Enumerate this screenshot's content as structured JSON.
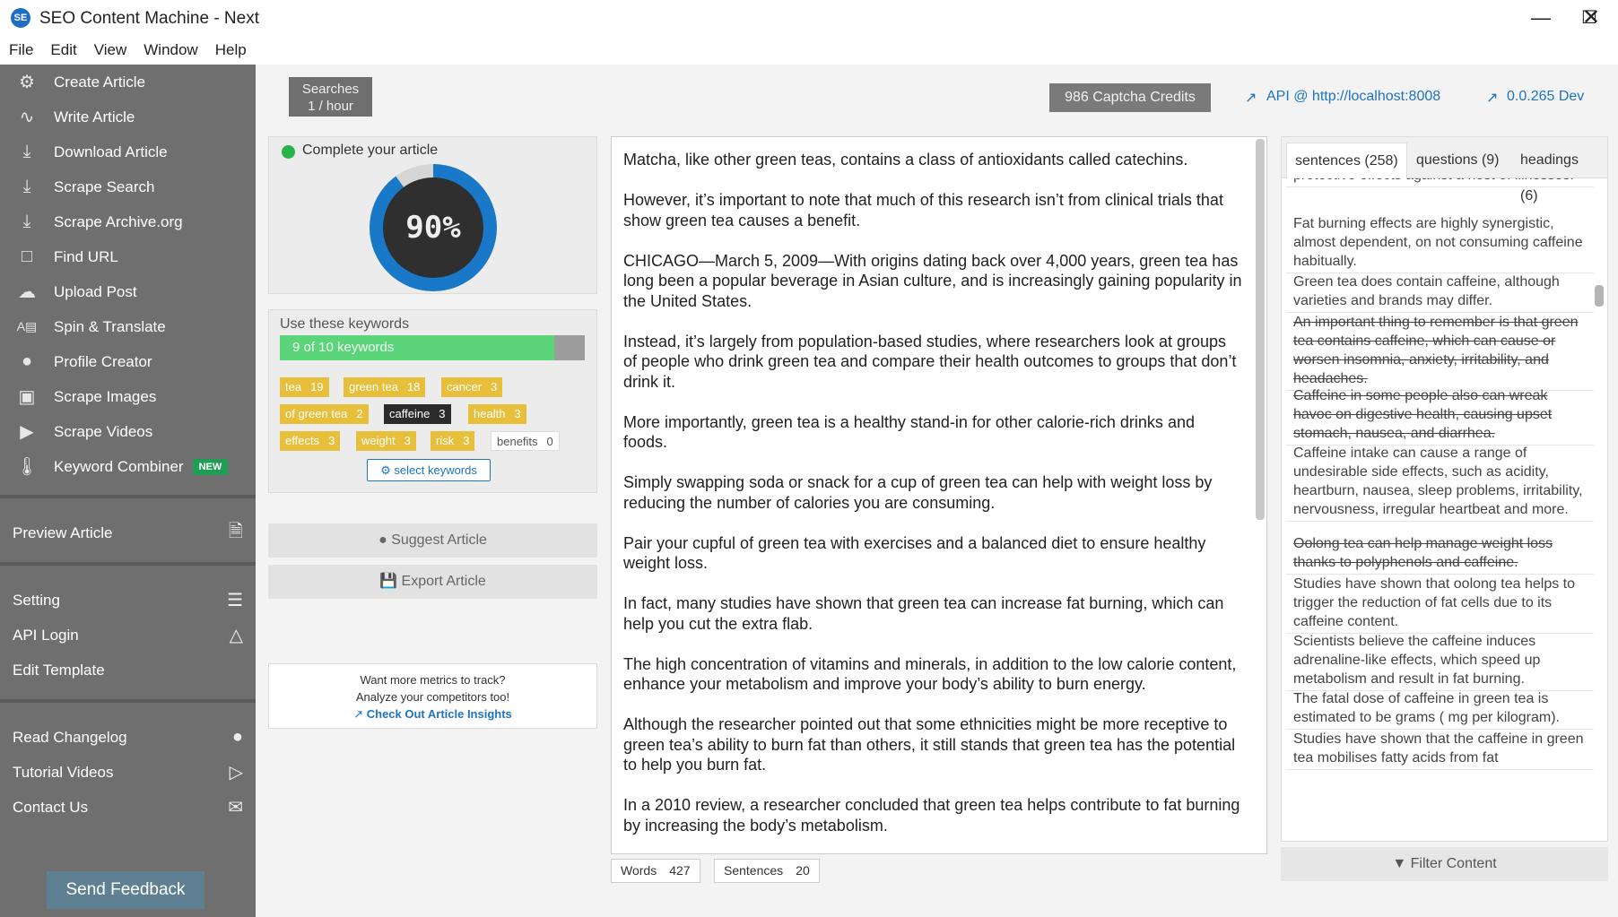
{
  "window": {
    "title": "SEO Content Machine - Next",
    "icon_text": "SE"
  },
  "menu": [
    "File",
    "Edit",
    "View",
    "Window",
    "Help"
  ],
  "sidebar": {
    "items": [
      {
        "label": "Create Article",
        "icon": "gear-icon"
      },
      {
        "label": "Write Article",
        "icon": "wave-icon"
      },
      {
        "label": "Download Article",
        "icon": "download-icon"
      },
      {
        "label": "Scrape Search",
        "icon": "download-icon"
      },
      {
        "label": "Scrape Archive.org",
        "icon": "download-icon"
      },
      {
        "label": "Find URL",
        "icon": "page-icon"
      },
      {
        "label": "Upload Post",
        "icon": "cloud-icon"
      },
      {
        "label": "Spin & Translate",
        "icon": "translate-icon"
      },
      {
        "label": "Profile Creator",
        "icon": "person-icon"
      },
      {
        "label": "Scrape Images",
        "icon": "image-icon"
      },
      {
        "label": "Scrape Videos",
        "icon": "video-icon"
      },
      {
        "label": "Keyword Combiner",
        "icon": "thermometer-icon",
        "badge": "NEW"
      }
    ],
    "preview": {
      "label": "Preview Article",
      "icon": "document-icon"
    },
    "settings": [
      {
        "label": "Setting",
        "icon": "sliders-icon"
      },
      {
        "label": "API Login",
        "icon": "flask-icon"
      },
      {
        "label": "Edit Template",
        "icon": ""
      }
    ],
    "help": [
      {
        "label": "Read Changelog",
        "icon": "lightbulb-icon"
      },
      {
        "label": "Tutorial Videos",
        "icon": "play-icon"
      },
      {
        "label": "Contact Us",
        "icon": "mail-icon"
      }
    ],
    "feedback": "Send Feedback"
  },
  "header": {
    "searches_line1": "Searches",
    "searches_line2": "1 / hour",
    "captcha": "986 Captcha Credits",
    "api_link": "API @ http://localhost:8008",
    "version_link": "0.0.265 Dev"
  },
  "progress": {
    "label": "Complete your article",
    "percent_text": "90%",
    "percent": 0.9
  },
  "keywords": {
    "label": "Use these keywords",
    "bar_text": "9 of 10 keywords",
    "fill": 0.9,
    "chips": [
      {
        "word": "tea",
        "count": "19",
        "style": "yellow"
      },
      {
        "word": "green tea",
        "count": "18",
        "style": "yellow"
      },
      {
        "word": "cancer",
        "count": "3",
        "style": "yellow"
      },
      {
        "word": "of green tea",
        "count": "2",
        "style": "yellow"
      },
      {
        "word": "caffeine",
        "count": "3",
        "style": "dark"
      },
      {
        "word": "health",
        "count": "3",
        "style": "yellow"
      },
      {
        "word": "effects",
        "count": "3",
        "style": "yellow"
      },
      {
        "word": "weight",
        "count": "3",
        "style": "yellow"
      },
      {
        "word": "risk",
        "count": "3",
        "style": "yellow"
      },
      {
        "word": "benefits",
        "count": "0",
        "style": "white"
      }
    ],
    "select_button": "select keywords"
  },
  "actions": {
    "suggest": "Suggest Article",
    "export": "Export Article"
  },
  "insights": {
    "line1": "Want more metrics to track?",
    "line2": "Analyze your competitors too!",
    "link": "Check Out Article Insights"
  },
  "article": {
    "paragraphs": [
      "Matcha, like other green teas, contains a class of antioxidants called catechins.",
      "However, it’s important to note that much of this research isn’t from clinical trials that show green tea causes a benefit.",
      "CHICAGO—March 5, 2009—With origins dating back over 4,000 years, green tea has long been a popular beverage in Asian culture, and is increasingly gaining popularity in the United States.",
      "Instead, it’s largely from population-based studies, where researchers look at groups of people who drink green tea and compare their health outcomes to groups that don’t drink it.",
      "More importantly, green tea is a healthy stand-in for other calorie-rich drinks and foods.",
      "Simply swapping soda or snack for a cup of green tea can help with weight loss by reducing the number of calories you are consuming.",
      "Pair your cupful of green tea with exercises and a balanced diet to ensure healthy weight loss.",
      "In fact, many studies have shown that green tea can increase fat burning, which can help you cut the extra flab.",
      "The high concentration of vitamins and minerals, in addition to the low calorie content, enhance your metabolism and improve your body’s ability to burn energy.",
      "Although the researcher pointed out that some ethnicities might be more receptive to green tea’s ability to burn fat than others, it still stands that green tea has the potential to help you burn fat.",
      "In a 2010 review, a researcher concluded that green tea helps contribute to fat burning by increasing the body’s metabolism."
    ]
  },
  "stats": {
    "words_label": "Words",
    "words": "427",
    "sentences_label": "Sentences",
    "sentences": "20"
  },
  "tabs": [
    {
      "label": "sentences (258)",
      "active": true
    },
    {
      "label": "questions (9)",
      "active": false
    },
    {
      "label": "headings (6)",
      "active": false
    }
  ],
  "sentences": [
    {
      "text": "protective effects against a host of illnesses.",
      "struck": false
    },
    {
      "text": "Fat burning effects are highly synergistic, almost dependent, on not consuming caffeine habitually.",
      "struck": false
    },
    {
      "text": "Green tea does contain caffeine, although varieties and brands may differ.",
      "struck": false
    },
    {
      "text": "An important thing to remember is that green tea contains caffeine, which can cause or worsen insomnia, anxiety, irritability, and headaches.",
      "struck": true
    },
    {
      "text": "Caffeine in some people also can wreak havoc on digestive health, causing upset stomach, nausea, and diarrhea.",
      "struck": true
    },
    {
      "text": "Caffeine intake can cause a range of undesirable side effects, such as acidity, heartburn, nausea, sleep problems, irritability, nervousness, irregular heartbeat and more.",
      "struck": false
    },
    {
      "text": "Oolong tea can help manage weight loss thanks to polyphenols and caffeine.",
      "struck": true
    },
    {
      "text": "Studies have shown that oolong tea helps to trigger the reduction of fat cells due to its caffeine content.",
      "struck": false
    },
    {
      "text": "Scientists believe the caffeine induces adrenaline-like effects, which speed up metabolism and result in fat burning.",
      "struck": false
    },
    {
      "text": "The fatal dose of caffeine in green tea is estimated to be grams ( mg per kilogram).",
      "struck": false
    },
    {
      "text": "Studies have shown that the caffeine in green tea mobilises fatty acids from fat",
      "struck": false
    }
  ],
  "filter": "Filter Content"
}
